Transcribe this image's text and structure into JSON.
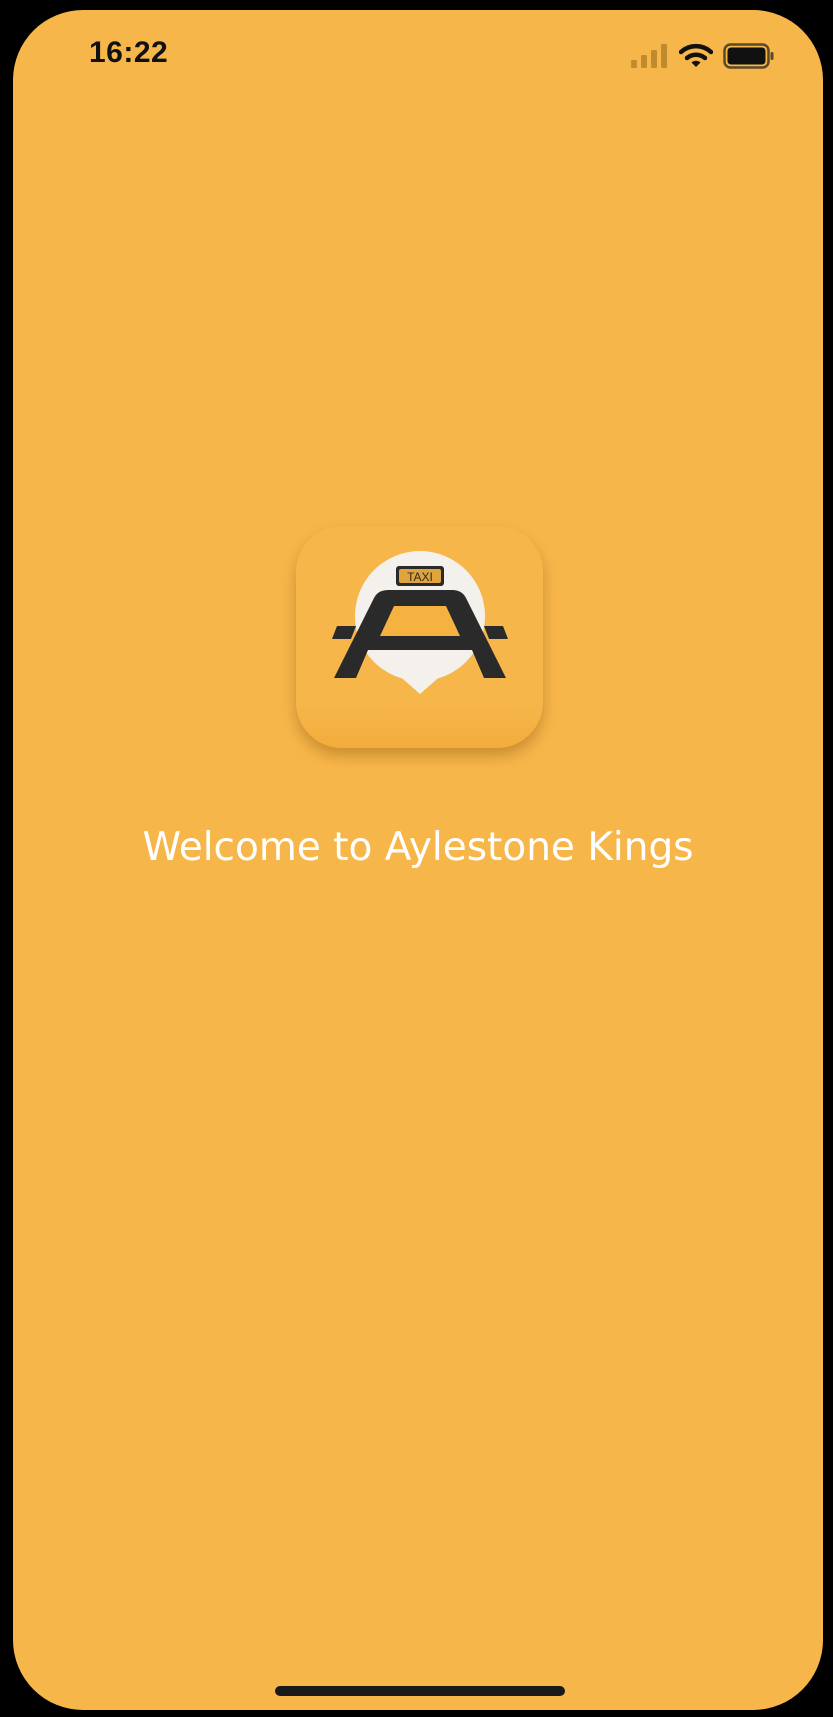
{
  "status_bar": {
    "time": "16:22",
    "icons": [
      "signal-icon",
      "wifi-icon",
      "battery-icon"
    ]
  },
  "splash": {
    "logo_icon": "taxi-logo-icon",
    "logo_text": "TAXI",
    "welcome_text": "Welcome to Aylestone Kings"
  },
  "colors": {
    "background": "#F7B64A",
    "text": "#FFFFFF",
    "status_text": "#111111"
  }
}
